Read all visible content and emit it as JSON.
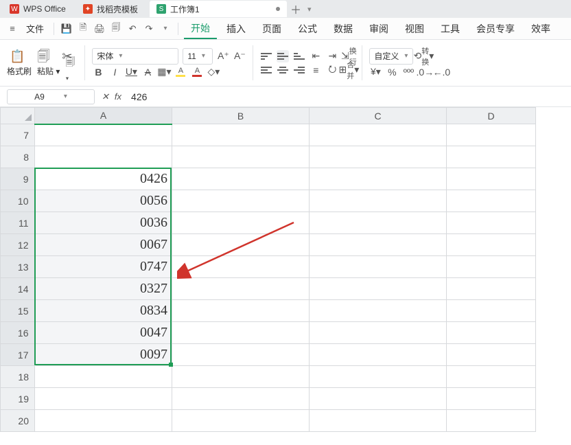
{
  "titlebar": {
    "app_label": "WPS Office",
    "tabs": [
      {
        "label": "找稻壳模板",
        "icon_bg": "#e04425"
      },
      {
        "label": "工作簿1",
        "icon_bg": "#2fa36f"
      }
    ]
  },
  "quickbar": {
    "menu_label": "文件"
  },
  "ribbon_tabs": {
    "items": [
      "开始",
      "插入",
      "页面",
      "公式",
      "数据",
      "审阅",
      "视图",
      "工具",
      "会员专享",
      "效率"
    ],
    "active_index": 0
  },
  "ribbon": {
    "format_label": "格式刷",
    "paste_label": "粘贴",
    "font_name": "宋体",
    "font_size": "11",
    "wrap_label": "换行",
    "merge_label": "合并",
    "numfmt_label": "自定义",
    "convert_label": "转换"
  },
  "formula": {
    "cell_ref": "A9",
    "formula_text": "426"
  },
  "grid": {
    "columns": [
      "A",
      "B",
      "C",
      "D"
    ],
    "row_start": 7,
    "row_end": 20,
    "selected_col": "A",
    "selection": {
      "r1": 9,
      "r2": 17
    },
    "data": {
      "9": "0426",
      "10": "0056",
      "11": "0036",
      "12": "0067",
      "13": "0747",
      "14": "0327",
      "15": "0834",
      "16": "0047",
      "17": "0097"
    }
  },
  "colors": {
    "accent": "#1f9d55",
    "highlight_fill": "#ffe04a",
    "font_color": "#d0342c"
  }
}
